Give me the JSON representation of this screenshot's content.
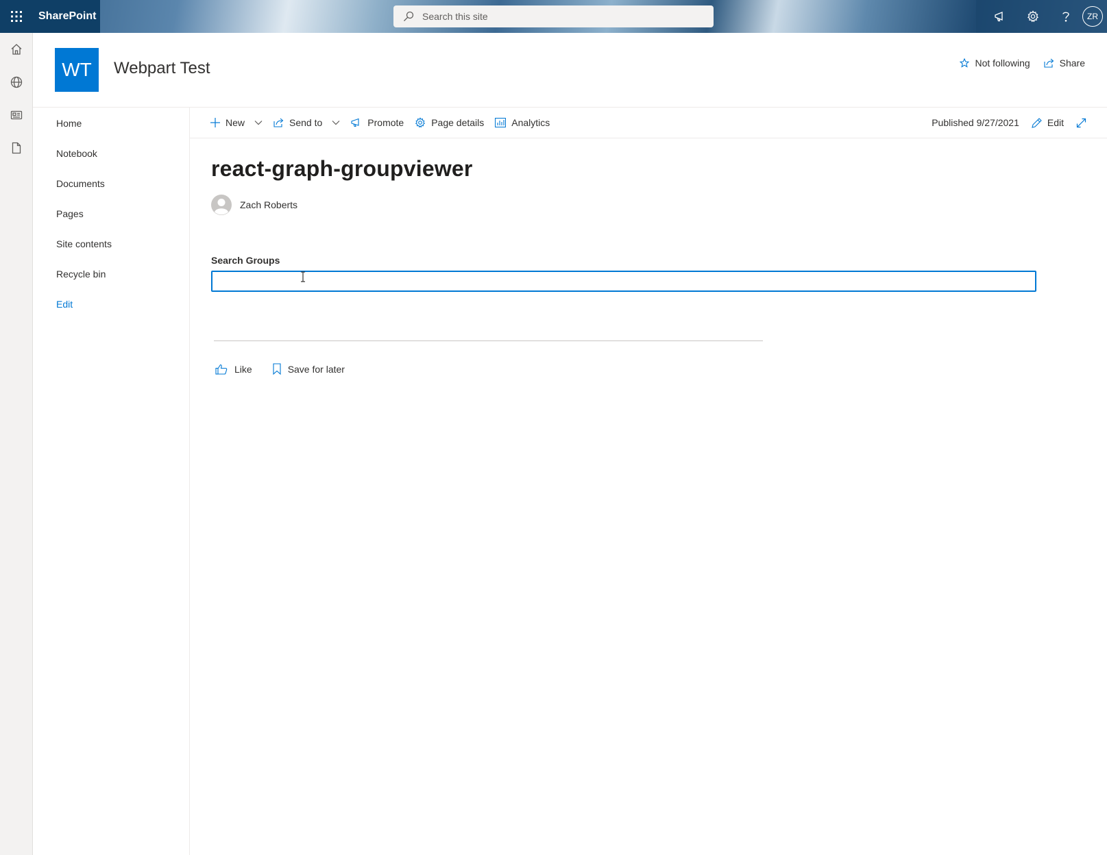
{
  "suite_bar": {
    "app_name": "SharePoint",
    "search_placeholder": "Search this site",
    "user_initials": "ZR",
    "icons": [
      "app-launcher-icon",
      "search-icon",
      "megaphone-icon",
      "settings-gear-icon",
      "help-icon"
    ]
  },
  "app_bar": {
    "icons": [
      "home-icon",
      "globe-icon",
      "news-icon",
      "document-icon"
    ]
  },
  "site_header": {
    "logo_initials": "WT",
    "site_title": "Webpart Test",
    "follow_label": "Not following",
    "share_label": "Share"
  },
  "left_nav": {
    "items": [
      {
        "label": "Home"
      },
      {
        "label": "Notebook"
      },
      {
        "label": "Documents"
      },
      {
        "label": "Pages"
      },
      {
        "label": "Site contents"
      },
      {
        "label": "Recycle bin"
      }
    ],
    "edit_label": "Edit"
  },
  "command_bar": {
    "new_label": "New",
    "send_to_label": "Send to",
    "promote_label": "Promote",
    "page_details_label": "Page details",
    "analytics_label": "Analytics",
    "published_text": "Published 9/27/2021",
    "edit_label": "Edit"
  },
  "page": {
    "title": "react-graph-groupviewer",
    "author": "Zach Roberts",
    "webpart": {
      "label": "Search Groups",
      "value": ""
    },
    "social": {
      "like_label": "Like",
      "save_label": "Save for later"
    }
  },
  "colors": {
    "accent": "#0078d4",
    "suite_bar_left": "#0f3f66",
    "text": "#323130"
  }
}
